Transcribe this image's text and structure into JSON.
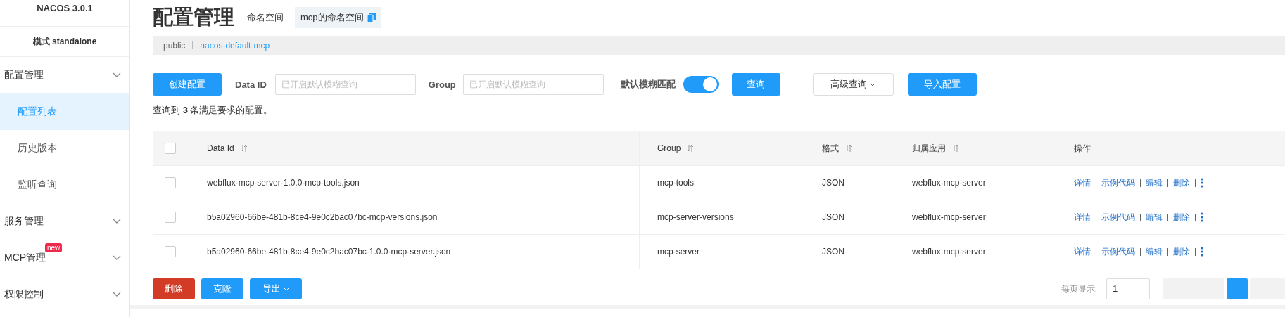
{
  "sidebar": {
    "title": "NACOS 3.0.1",
    "mode": "模式 standalone",
    "items": [
      {
        "label": "配置管理",
        "children": [
          {
            "label": "配置列表",
            "selected": true
          },
          {
            "label": "历史版本",
            "selected": false
          },
          {
            "label": "监听查询",
            "selected": false
          }
        ]
      },
      {
        "label": "服务管理"
      },
      {
        "label": "MCP管理",
        "badge": "new"
      },
      {
        "label": "权限控制"
      }
    ]
  },
  "header": {
    "title": "配置管理",
    "namespace_label": "命名空间",
    "namespace": "mcp的命名空间"
  },
  "namespaces": [
    {
      "label": "public",
      "selected": false
    },
    {
      "label": "nacos-default-mcp",
      "selected": true
    }
  ],
  "toolbar": {
    "create_button": "创建配置",
    "data_id_label": "Data ID",
    "data_id_placeholder": "已开启默认模糊查询",
    "group_label": "Group",
    "group_placeholder": "已开启默认模糊查询",
    "fuzzy_label": "默认模糊匹配",
    "fuzzy_on": true,
    "search_button": "查询",
    "advanced_button": "高级查询",
    "import_button": "导入配置"
  },
  "result": "查询到 **3** 条满足要求的配置。",
  "table": {
    "all_checked": false,
    "columns": [
      {
        "label": "Data Id",
        "sortable": true
      },
      {
        "label": "Group",
        "sortable": true
      },
      {
        "label": "格式",
        "sortable": true
      },
      {
        "label": "归属应用",
        "sortable": true
      },
      {
        "label": "操作",
        "sortable": false
      }
    ],
    "rows": [
      {
        "checked": false,
        "data_id": "webflux-mcp-server-1.0.0-mcp-tools.json",
        "group": "mcp-tools",
        "format": "JSON",
        "app": "webflux-mcp-server",
        "actions": [
          "详情",
          "示例代码",
          "编辑",
          "删除"
        ]
      },
      {
        "checked": false,
        "data_id": "b5a02960-66be-481b-8ce4-9e0c2bac07bc-mcp-versions.json",
        "group": "mcp-server-versions",
        "format": "JSON",
        "app": "webflux-mcp-server",
        "actions": [
          "详情",
          "示例代码",
          "编辑",
          "删除"
        ]
      },
      {
        "checked": false,
        "data_id": "b5a02960-66be-481b-8ce4-9e0c2bac07bc-1.0.0-mcp-server.json",
        "group": "mcp-server",
        "format": "JSON",
        "app": "webflux-mcp-server",
        "actions": [
          "详情",
          "示例代码",
          "编辑",
          "删除"
        ]
      }
    ]
  },
  "bulk_buttons": [
    {
      "label": "删除",
      "kind": "danger"
    },
    {
      "label": "克隆",
      "kind": "primary"
    },
    {
      "label": "导出",
      "kind": "dropdown"
    }
  ],
  "pagination": {
    "label": "每页显示:",
    "page_size": "1"
  }
}
